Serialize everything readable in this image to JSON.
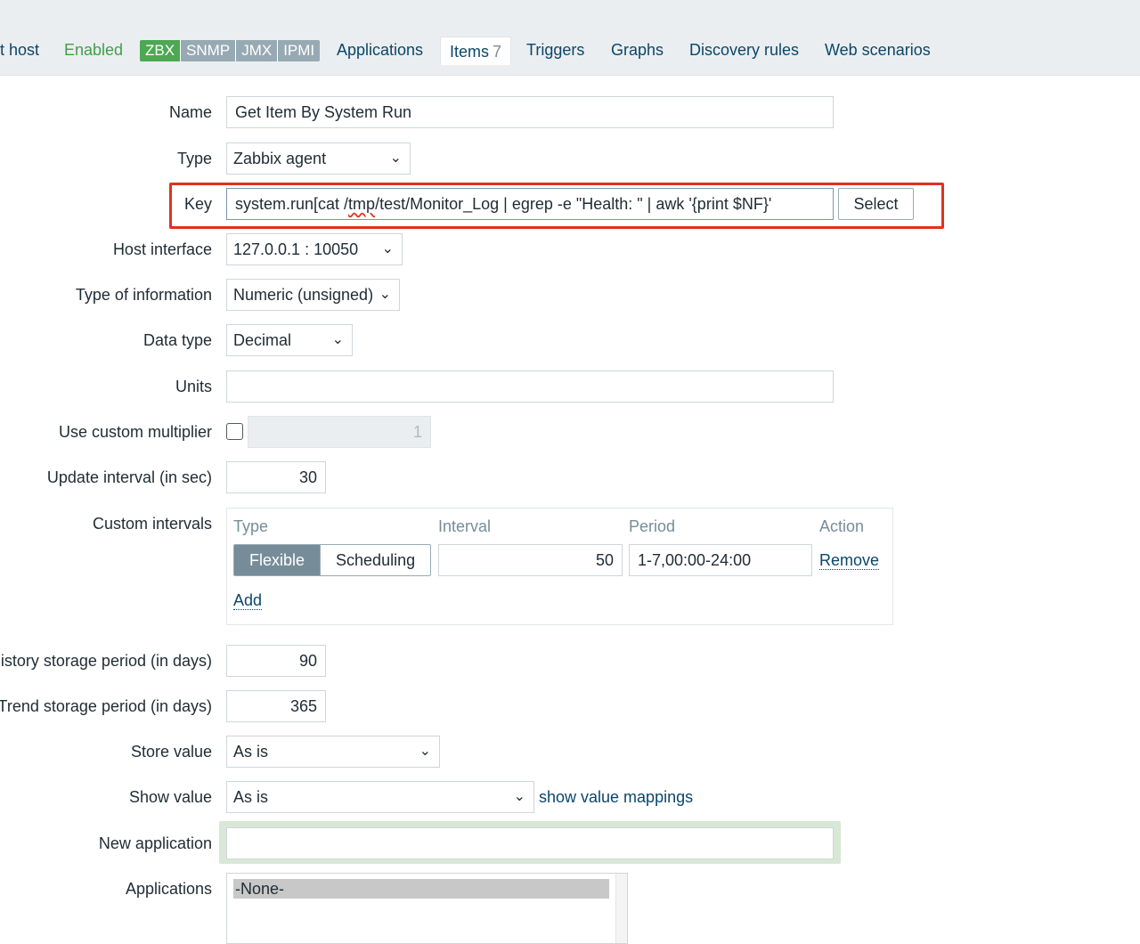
{
  "nav": {
    "host": "t host",
    "status": "Enabled",
    "badges": [
      "ZBX",
      "SNMP",
      "JMX",
      "IPMI"
    ],
    "applications": "Applications",
    "items": "Items",
    "items_count": "7",
    "triggers": "Triggers",
    "graphs": "Graphs",
    "discovery": "Discovery rules",
    "web": "Web scenarios"
  },
  "form": {
    "name_label": "Name",
    "name_value": "Get Item By System Run",
    "type_label": "Type",
    "type_value": "Zabbix agent",
    "key_label": "Key",
    "key_value_a": "system.run[cat /",
    "key_value_b": "tmp",
    "key_value_c": "/test/Monitor_Log | egrep -e \"Health: \" | awk '{print $NF}'",
    "select_button": "Select",
    "interface_label": "Host interface",
    "interface_value": "127.0.0.1 : 10050",
    "info_label": "Type of information",
    "info_value": "Numeric (unsigned)",
    "datatype_label": "Data type",
    "datatype_value": "Decimal",
    "units_label": "Units",
    "units_value": "",
    "multiplier_label": "Use custom multiplier",
    "multiplier_value": "1",
    "interval_label": "Update interval (in sec)",
    "interval_value": "30",
    "custom_label": "Custom intervals",
    "custom": {
      "col_type": "Type",
      "col_interval": "Interval",
      "col_period": "Period",
      "col_action": "Action",
      "flexible": "Flexible",
      "scheduling": "Scheduling",
      "interval": "50",
      "period": "1-7,00:00-24:00",
      "remove": "Remove",
      "add": "Add"
    },
    "history_label": "istory storage period (in days)",
    "history_value": "90",
    "trend_label": "Trend storage period (in days)",
    "trend_value": "365",
    "store_label": "Store value",
    "store_value": "As is",
    "show_label": "Show value",
    "show_value": "As is",
    "show_mappings": "show value mappings",
    "newapp_label": "New application",
    "newapp_value": "",
    "apps_label": "Applications",
    "apps_selected": "-None-"
  },
  "colors": {
    "highlight": "#e0311f",
    "link": "#0a466a",
    "enabled": "#429e47",
    "badge_active": "#4ca853",
    "badge_inactive": "#97aab3"
  }
}
